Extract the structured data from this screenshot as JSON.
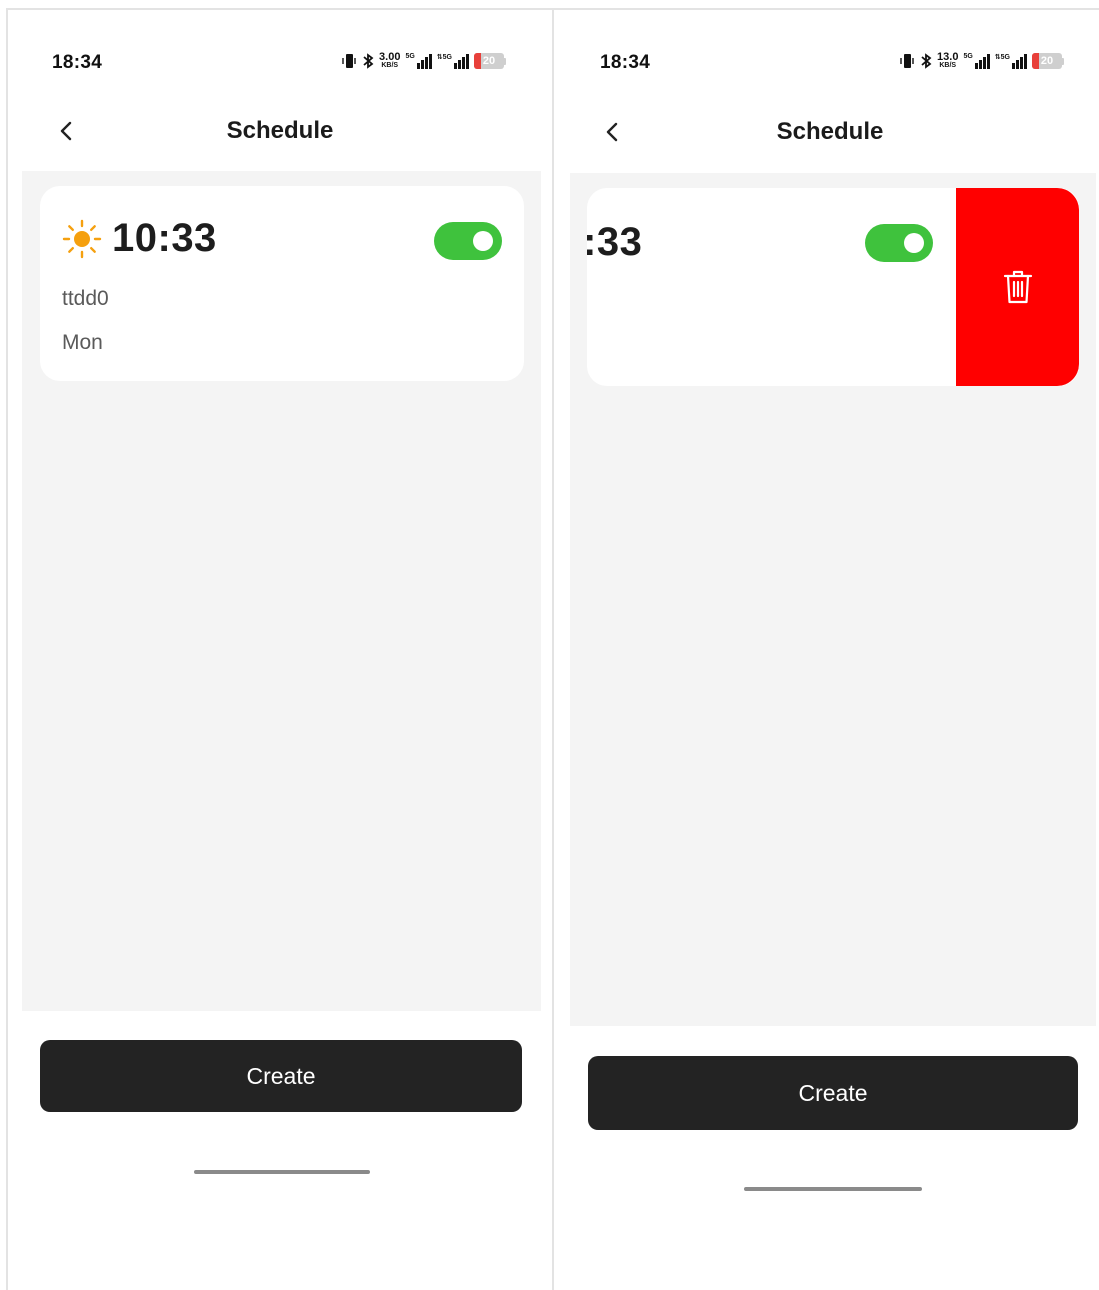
{
  "screens": [
    {
      "status_bar": {
        "time": "18:34",
        "net_speed": "3.00",
        "net_unit": "KB/S",
        "sim1_tag": "5G",
        "sim2_tag": "⇅5G",
        "battery": "20"
      },
      "header": {
        "title": "Schedule"
      },
      "schedule": {
        "time": "10:33",
        "name": "ttdd0",
        "days": "Mon",
        "enabled": true,
        "period_icon": "sun-icon"
      },
      "create_label": "Create"
    },
    {
      "status_bar": {
        "time": "18:34",
        "net_speed": "13.0",
        "net_unit": "KB/S",
        "sim1_tag": "5G",
        "sim2_tag": "⇅5G",
        "battery": "20"
      },
      "header": {
        "title": "Schedule"
      },
      "schedule": {
        "time_partial": ":33",
        "enabled": true
      },
      "delete_action": {
        "icon": "trash-icon",
        "color": "#ff0000"
      },
      "create_label": "Create"
    }
  ],
  "colors": {
    "toggle_on": "#3fc23d",
    "sun": "#f5a00f",
    "button_bg": "#232323",
    "delete": "#ff0000"
  }
}
